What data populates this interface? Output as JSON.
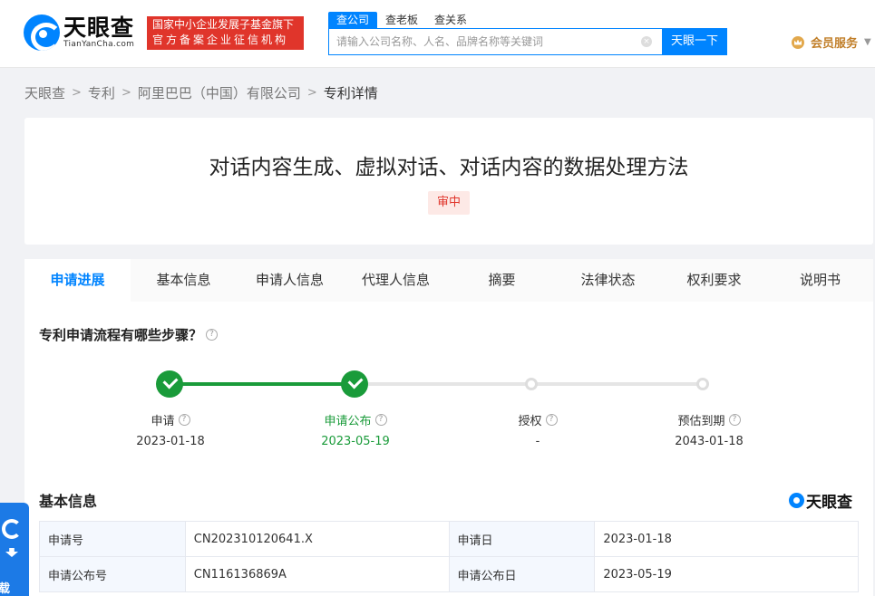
{
  "header": {
    "logo_cn": "天眼查",
    "logo_en": "TianYanCha.com",
    "badge_line1": "国家中小企业发展子基金旗下",
    "badge_line2": "官方备案企业征信机构",
    "search_tabs": [
      "查公司",
      "查老板",
      "查关系"
    ],
    "search_placeholder": "请输入公司名称、人名、品牌名称等关键词",
    "search_button": "天眼一下",
    "vip_label": "会员服务"
  },
  "breadcrumb": [
    "天眼查",
    "专利",
    "阿里巴巴（中国）有限公司",
    "专利详情"
  ],
  "patent": {
    "title": "对话内容生成、虚拟对话、对话内容的数据处理方法",
    "status": "审中"
  },
  "tabs": [
    "申请进展",
    "基本信息",
    "申请人信息",
    "代理人信息",
    "摘要",
    "法律状态",
    "权利要求",
    "说明书"
  ],
  "progress": {
    "question": "专利申请流程有哪些步骤？",
    "steps": [
      {
        "label": "申请",
        "date": "2023-01-18",
        "done": true
      },
      {
        "label": "申请公布",
        "date": "2023-05-19",
        "done": true
      },
      {
        "label": "授权",
        "date": "-",
        "done": false
      },
      {
        "label": "预估到期",
        "date": "2043-01-18",
        "done": false
      }
    ]
  },
  "basic_info": {
    "title": "基本信息",
    "watermark": "天眼查",
    "rows": [
      {
        "k1": "申请号",
        "v1": "CN202310120641.X",
        "k2": "申请日",
        "v2": "2023-01-18"
      },
      {
        "k1": "申请公布号",
        "v1": "CN116136869A",
        "k2": "申请公布日",
        "v2": "2023-05-19"
      }
    ]
  },
  "float_widget": {
    "label": "载"
  }
}
